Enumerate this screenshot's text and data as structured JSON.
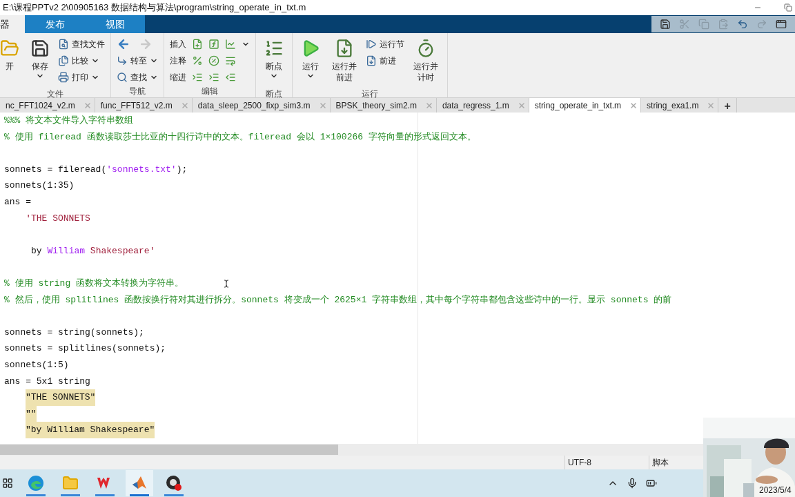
{
  "title": "E:\\课程PPTv2 2\\00905163 数据结构与算法\\program\\string_operate_in_txt.m",
  "ribbon_tabs": [
    {
      "label": "器",
      "selected": true
    },
    {
      "label": "发布",
      "selected": false
    },
    {
      "label": "视图",
      "selected": false
    }
  ],
  "ribbon_groups": [
    {
      "label": "文件",
      "columns": [
        {
          "kind": "large",
          "buttons": [
            {
              "label": "开",
              "dropdown": false
            }
          ]
        },
        {
          "kind": "large",
          "buttons": [
            {
              "label": "保存",
              "dropdown": true
            }
          ]
        },
        {
          "kind": "small",
          "buttons": [
            {
              "label": "查找文件",
              "dropdown": false
            },
            {
              "label": "比较",
              "dropdown": true
            },
            {
              "label": "打印",
              "dropdown": true
            }
          ]
        }
      ]
    },
    {
      "label": "导航",
      "columns": [
        {
          "kind": "small",
          "buttons": [
            {
              "kind": "arrows",
              "forward_enabled": false
            },
            {
              "label": "转至",
              "dropdown": true
            },
            {
              "label": "查找",
              "dropdown": true
            }
          ]
        }
      ]
    },
    {
      "label": "编辑",
      "columns": [
        {
          "kind": "rows",
          "buttons": [
            {
              "label": "插入",
              "dropdown": true
            },
            {
              "label": "注释",
              "dropdown": false
            },
            {
              "label": "缩进",
              "dropdown": false
            }
          ]
        }
      ]
    },
    {
      "label": "断点",
      "columns": [
        {
          "kind": "large",
          "buttons": [
            {
              "label": "断点",
              "dropdown": true
            }
          ]
        }
      ]
    },
    {
      "label": "运行",
      "columns": [
        {
          "kind": "large",
          "buttons": [
            {
              "label": "运行",
              "dropdown": true
            }
          ]
        },
        {
          "kind": "large",
          "buttons": [
            {
              "label": "运行并前进",
              "dropdown": false
            }
          ]
        },
        {
          "kind": "small",
          "buttons": [
            {
              "label": "运行节",
              "dropdown": false
            },
            {
              "label": "前进",
              "dropdown": false
            }
          ]
        },
        {
          "kind": "large",
          "buttons": [
            {
              "label": "运行并计时",
              "dropdown": false
            }
          ]
        }
      ]
    }
  ],
  "editor_tabs": [
    {
      "label": "nc_FFT1024_v2.m",
      "selected": false
    },
    {
      "label": "func_FFT512_v2.m",
      "selected": false
    },
    {
      "label": "data_sleep_2500_fixp_sim3.m",
      "selected": false
    },
    {
      "label": "BPSK_theory_sim2.m",
      "selected": false
    },
    {
      "label": "data_regress_1.m",
      "selected": false
    },
    {
      "label": "string_operate_in_txt.m",
      "selected": true
    },
    {
      "label": "string_exa1.m",
      "selected": false
    }
  ],
  "new_tab": "+",
  "code_lines": [
    {
      "kind": "line",
      "segments": [
        {
          "kind": "comment",
          "text": "%%% 将文本文件导入字符串数组"
        }
      ]
    },
    {
      "kind": "line",
      "segments": [
        {
          "kind": "comment",
          "text": "% 使用 fileread 函数读取莎士比亚的十四行诗中的文本。fileread 会以 1×100266 字符向量的形式返回文本。"
        }
      ]
    },
    {
      "kind": "blank"
    },
    {
      "kind": "line",
      "segments": [
        {
          "kind": "plain",
          "text": "sonnets = fileread("
        },
        {
          "kind": "string",
          "text": "'sonnets.txt'"
        },
        {
          "kind": "plain",
          "text": ");"
        }
      ]
    },
    {
      "kind": "line",
      "segments": [
        {
          "kind": "plain",
          "text": "sonnets(1:35)"
        }
      ]
    },
    {
      "kind": "line",
      "segments": [
        {
          "kind": "plain",
          "text": "ans ="
        }
      ]
    },
    {
      "kind": "line",
      "segments": [
        {
          "kind": "output",
          "text": "    'THE SONNETS"
        }
      ]
    },
    {
      "kind": "blank"
    },
    {
      "kind": "line",
      "segments": [
        {
          "kind": "plain",
          "text": "     by "
        },
        {
          "kind": "string",
          "text": "William "
        },
        {
          "kind": "output",
          "text": "Shakespeare'"
        }
      ]
    },
    {
      "kind": "blank"
    },
    {
      "kind": "line",
      "segments": [
        {
          "kind": "comment",
          "text": "% 使用 string 函数将文本转换为字符串。"
        }
      ]
    },
    {
      "kind": "line",
      "segments": [
        {
          "kind": "comment",
          "text": "% 然后，使用 splitlines 函数按换行符对其进行拆分。sonnets 将变成一个 2625×1 字符串数组，其中每个字符串都包含这些诗中的一行。显示 sonnets 的前"
        }
      ]
    },
    {
      "kind": "blank"
    },
    {
      "kind": "line",
      "segments": [
        {
          "kind": "plain",
          "text": "sonnets = string(sonnets);"
        }
      ]
    },
    {
      "kind": "line",
      "segments": [
        {
          "kind": "plain",
          "text": "sonnets = splitlines(sonnets);"
        }
      ]
    },
    {
      "kind": "line",
      "segments": [
        {
          "kind": "plain",
          "text": "sonnets(1:5)"
        }
      ]
    },
    {
      "kind": "line",
      "segments": [
        {
          "kind": "plain",
          "text": "ans = 5x1 string"
        }
      ]
    },
    {
      "kind": "indented",
      "segments": [
        {
          "kind": "highlight",
          "text": "\"THE SONNETS\""
        }
      ]
    },
    {
      "kind": "indented",
      "segments": [
        {
          "kind": "highlight",
          "text": "\"\""
        }
      ]
    },
    {
      "kind": "indented",
      "segments": [
        {
          "kind": "highlight",
          "text": "\"by William Shakespeare\""
        }
      ]
    }
  ],
  "status_bar": {
    "encoding": "UTF-8",
    "file_type": "脚本"
  },
  "taskbar": {
    "apps": [
      {
        "kind": "taskview",
        "selected": false
      },
      {
        "kind": "browser",
        "selected": false
      },
      {
        "kind": "folder",
        "selected": false
      },
      {
        "kind": "office",
        "selected": false
      },
      {
        "kind": "matlab",
        "selected": true
      },
      {
        "kind": "recorder",
        "selected": false
      }
    ],
    "date": "2023/5/4"
  }
}
